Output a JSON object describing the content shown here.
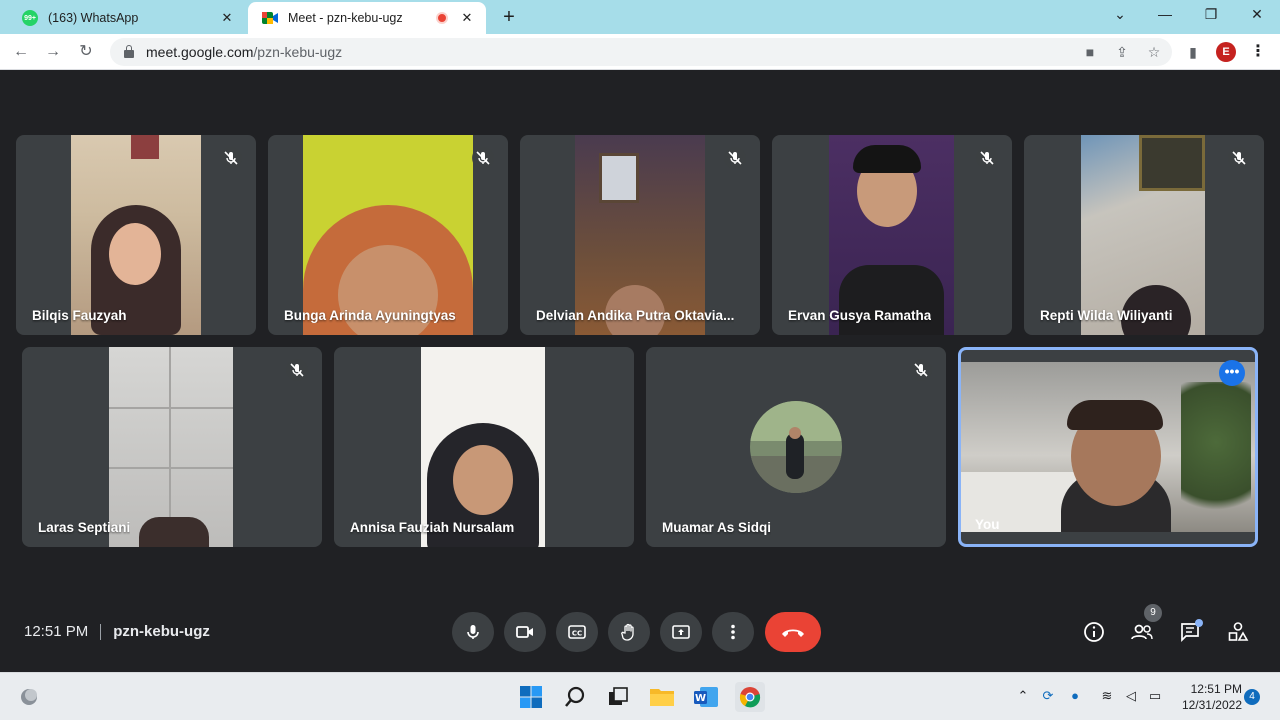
{
  "browser": {
    "tabs": [
      {
        "title": "(163) WhatsApp",
        "favicon_badge": "99+",
        "favicon": "whatsapp-icon",
        "active": false
      },
      {
        "title": "Meet - pzn-kebu-ugz",
        "favicon": "google-meet-icon",
        "active": true
      }
    ],
    "url_host": "meet.google.com",
    "url_path": "/pzn-kebu-ugz",
    "profile_initial": "E"
  },
  "meeting": {
    "participants_row1": [
      {
        "name": "Bilqis Fauzyah",
        "muted": true
      },
      {
        "name": "Bunga Arinda Ayuningtyas",
        "muted": true
      },
      {
        "name": "Delvian Andika Putra Oktavia...",
        "muted": true
      },
      {
        "name": "Ervan Gusya Ramatha",
        "muted": true
      },
      {
        "name": "Repti Wilda Wiliyanti",
        "muted": true
      }
    ],
    "participants_row2": [
      {
        "name": "Laras Septiani",
        "muted": true
      },
      {
        "name": "Annisa Fauziah Nursalam",
        "muted": false
      },
      {
        "name": "Muamar As Sidqi",
        "muted": true
      }
    ],
    "self_label": "You",
    "time": "12:51 PM",
    "code": "pzn-kebu-ugz",
    "people_count": "9"
  },
  "taskbar": {
    "time": "12:51 PM",
    "date": "12/31/2022",
    "notification_count": "4"
  },
  "colors": {
    "background": "#202124",
    "tile": "#3c4043",
    "end_call": "#ea4335",
    "self_border": "#8ab4f8",
    "tab_strip": "#a6dde9"
  }
}
